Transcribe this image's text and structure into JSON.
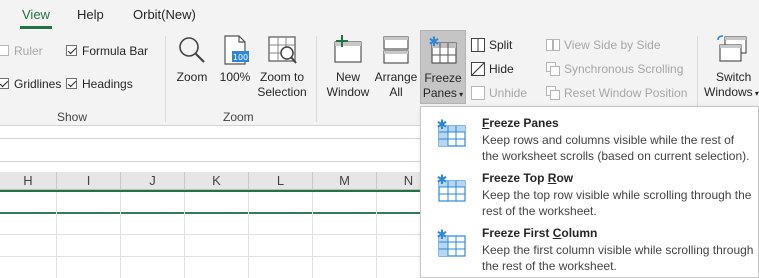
{
  "tabs": {
    "view": "View",
    "help": "Help",
    "orbit": "Orbit(New)"
  },
  "show_group": {
    "label": "Show",
    "ruler": "Ruler",
    "formula_bar": "Formula Bar",
    "gridlines": "Gridlines",
    "headings": "Headings"
  },
  "zoom_group": {
    "label": "Zoom",
    "zoom": "Zoom",
    "hundred": "100%",
    "hundred_icon_text": "100",
    "zoom_to_selection_1": "Zoom to",
    "zoom_to_selection_2": "Selection"
  },
  "window_group": {
    "new_window_1": "New",
    "new_window_2": "Window",
    "arrange_all_1": "Arrange",
    "arrange_all_2": "All",
    "freeze_panes_1": "Freeze",
    "freeze_panes_2": "Panes",
    "split": "Split",
    "hide": "Hide",
    "unhide": "Unhide",
    "view_side_by_side": "View Side by Side",
    "sync_scrolling": "Synchronous Scrolling",
    "reset_window_position": "Reset Window Position",
    "switch_windows_1": "Switch",
    "switch_windows_2": "Windows"
  },
  "columns": [
    "H",
    "I",
    "J",
    "K",
    "L",
    "M",
    "N"
  ],
  "menu": {
    "items": [
      {
        "title_pre": "",
        "title_ul": "F",
        "title_post": "reeze Panes",
        "desc": "Keep rows and columns visible while the rest of the worksheet scrolls (based on current selection)."
      },
      {
        "title_pre": "Freeze Top ",
        "title_ul": "R",
        "title_post": "ow",
        "desc": "Keep the top row visible while scrolling through the rest of the worksheet."
      },
      {
        "title_pre": "Freeze First ",
        "title_ul": "C",
        "title_post": "olumn",
        "desc": "Keep the first column visible while scrolling through the rest of the worksheet."
      }
    ]
  },
  "colors": {
    "accent": "#217346",
    "icon_blue": "#2b88d8",
    "ribbon_bg": "#f3f3f3"
  },
  "icons": {
    "zoom": "magnifier-icon",
    "hundred": "page-100-icon",
    "zoom_selection": "zoom-selection-icon",
    "new_window": "new-window-icon",
    "arrange_all": "arrange-all-icon",
    "freeze_panes": "freeze-panes-icon",
    "split": "split-icon",
    "hide": "hide-icon",
    "unhide": "unhide-icon",
    "switch_windows": "switch-windows-icon"
  }
}
